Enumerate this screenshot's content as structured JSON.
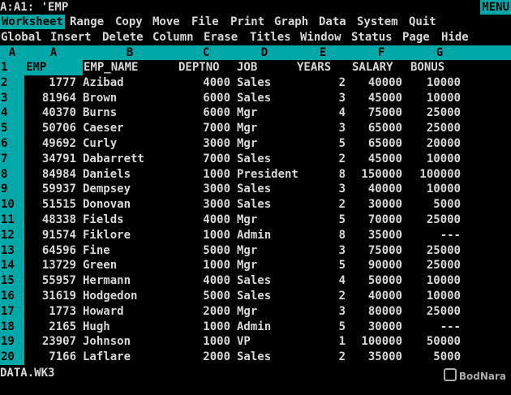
{
  "status": {
    "cell_address": "A:A1: 'EMP",
    "mode": "MENU",
    "file": "DATA.WK3"
  },
  "menu": {
    "main": [
      "Worksheet",
      "Range",
      "Copy",
      "Move",
      "File",
      "Print",
      "Graph",
      "Data",
      "System",
      "Quit"
    ],
    "sub": [
      "Global",
      "Insert",
      "Delete",
      "Column",
      "Erase",
      "Titles",
      "Window",
      "Status",
      "Page",
      "Hide"
    ]
  },
  "sheet": {
    "corner": "A",
    "columns": [
      "A",
      "B",
      "C",
      "D",
      "E",
      "F",
      "G"
    ],
    "rows": [
      {
        "n": "1",
        "a": "EMP",
        "b": "EMP_NAME",
        "c": "DEPTNO",
        "d": "JOB",
        "e": "YEARS",
        "f": "SALARY",
        "g": "BONUS"
      },
      {
        "n": "2",
        "a": "1777",
        "b": "Azibad",
        "c": "4000",
        "d": "Sales",
        "e": "2",
        "f": "40000",
        "g": "10000"
      },
      {
        "n": "3",
        "a": "81964",
        "b": "Brown",
        "c": "6000",
        "d": "Sales",
        "e": "3",
        "f": "45000",
        "g": "10000"
      },
      {
        "n": "4",
        "a": "40370",
        "b": "Burns",
        "c": "6000",
        "d": "Mgr",
        "e": "4",
        "f": "75000",
        "g": "25000"
      },
      {
        "n": "5",
        "a": "50706",
        "b": "Caeser",
        "c": "7000",
        "d": "Mgr",
        "e": "3",
        "f": "65000",
        "g": "25000"
      },
      {
        "n": "6",
        "a": "49692",
        "b": "Curly",
        "c": "3000",
        "d": "Mgr",
        "e": "5",
        "f": "65000",
        "g": "20000"
      },
      {
        "n": "7",
        "a": "34791",
        "b": "Dabarrett",
        "c": "7000",
        "d": "Sales",
        "e": "2",
        "f": "45000",
        "g": "10000"
      },
      {
        "n": "8",
        "a": "84984",
        "b": "Daniels",
        "c": "1000",
        "d": "President",
        "e": "8",
        "f": "150000",
        "g": "100000"
      },
      {
        "n": "9",
        "a": "59937",
        "b": "Dempsey",
        "c": "3000",
        "d": "Sales",
        "e": "3",
        "f": "40000",
        "g": "10000"
      },
      {
        "n": "10",
        "a": "51515",
        "b": "Donovan",
        "c": "3000",
        "d": "Sales",
        "e": "2",
        "f": "30000",
        "g": "5000"
      },
      {
        "n": "11",
        "a": "48338",
        "b": "Fields",
        "c": "4000",
        "d": "Mgr",
        "e": "5",
        "f": "70000",
        "g": "25000"
      },
      {
        "n": "12",
        "a": "91574",
        "b": "Fiklore",
        "c": "1000",
        "d": "Admin",
        "e": "8",
        "f": "35000",
        "g": "---"
      },
      {
        "n": "13",
        "a": "64596",
        "b": "Fine",
        "c": "5000",
        "d": "Mgr",
        "e": "3",
        "f": "75000",
        "g": "25000"
      },
      {
        "n": "14",
        "a": "13729",
        "b": "Green",
        "c": "1000",
        "d": "Mgr",
        "e": "5",
        "f": "90000",
        "g": "25000"
      },
      {
        "n": "15",
        "a": "55957",
        "b": "Hermann",
        "c": "4000",
        "d": "Sales",
        "e": "4",
        "f": "50000",
        "g": "10000"
      },
      {
        "n": "16",
        "a": "31619",
        "b": "Hodgedon",
        "c": "5000",
        "d": "Sales",
        "e": "2",
        "f": "40000",
        "g": "10000"
      },
      {
        "n": "17",
        "a": "1773",
        "b": "Howard",
        "c": "2000",
        "d": "Mgr",
        "e": "3",
        "f": "80000",
        "g": "25000"
      },
      {
        "n": "18",
        "a": "2165",
        "b": "Hugh",
        "c": "1000",
        "d": "Admin",
        "e": "5",
        "f": "30000",
        "g": "---"
      },
      {
        "n": "19",
        "a": "23907",
        "b": "Johnson",
        "c": "1000",
        "d": "VP",
        "e": "1",
        "f": "100000",
        "g": "50000"
      },
      {
        "n": "20",
        "a": "7166",
        "b": "Laflare",
        "c": "2000",
        "d": "Sales",
        "e": "2",
        "f": "35000",
        "g": "5000"
      }
    ]
  },
  "watermark": "BodNara"
}
